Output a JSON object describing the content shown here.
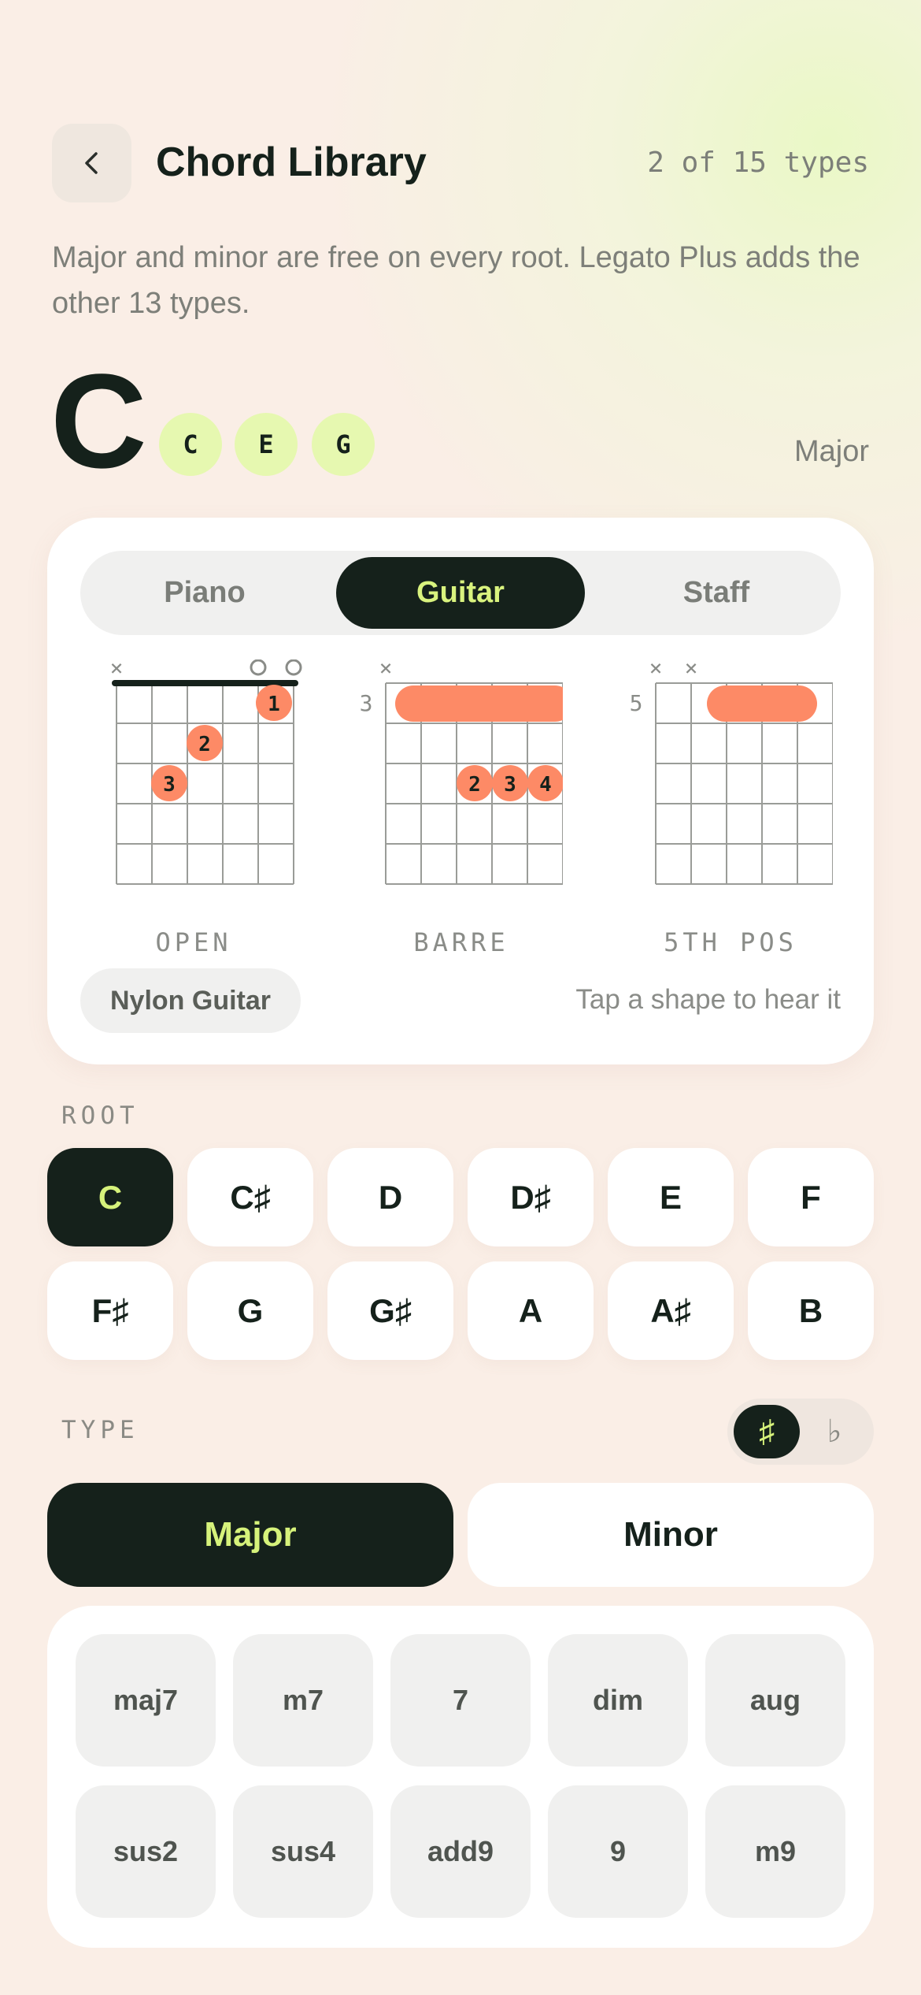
{
  "header": {
    "title": "Chord Library",
    "type_count": "2 of 15 types",
    "subtitle": "Major and minor are free on every root. Legato Plus adds the other 13 types."
  },
  "chord": {
    "root": "C",
    "notes": [
      "C",
      "E",
      "G"
    ],
    "quality": "Major"
  },
  "instrument_tabs": {
    "piano": "Piano",
    "guitar": "Guitar",
    "staff": "Staff",
    "active": "Guitar"
  },
  "shapes": {
    "open": {
      "label": "OPEN",
      "mute": "×",
      "open_marker": "o",
      "fingers": [
        "1",
        "2",
        "3"
      ]
    },
    "barre": {
      "label": "BARRE",
      "fret": "3",
      "mute": "×",
      "fingers": [
        "2",
        "3",
        "4"
      ]
    },
    "fifth": {
      "label": "5TH POS",
      "fret": "5",
      "mute": "×"
    }
  },
  "sound": {
    "instrument": "Nylon Guitar",
    "hint": "Tap a shape to hear it"
  },
  "root_section": {
    "label": "ROOT",
    "roots": [
      "C",
      "C♯",
      "D",
      "D♯",
      "E",
      "F",
      "F♯",
      "G",
      "G♯",
      "A",
      "A♯",
      "B"
    ],
    "selected": "C"
  },
  "type_section": {
    "label": "TYPE",
    "sharp": "♯",
    "flat": "♭",
    "major": "Major",
    "minor": "Minor",
    "extended": [
      "maj7",
      "m7",
      "7",
      "dim",
      "aug",
      "sus2",
      "sus4",
      "add9",
      "9",
      "m9"
    ]
  },
  "colors": {
    "dark": "#15211b",
    "accent_lime": "#d6f27b",
    "finger_coral": "#fd8a66",
    "chip_lime": "#e6f8b0"
  }
}
